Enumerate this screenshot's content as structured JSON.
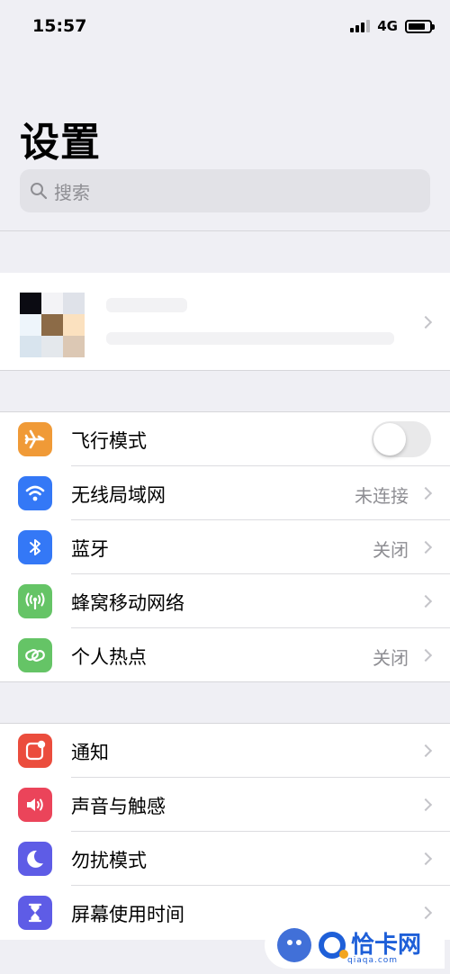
{
  "status_bar": {
    "time": "15:57",
    "network": "4G",
    "signal_bars_active": 3,
    "signal_bars_total": 4
  },
  "header": {
    "title": "设置"
  },
  "search": {
    "placeholder": "搜索"
  },
  "profile": {
    "avatar_colors": [
      "#0b0b12",
      "#f3f3f6",
      "#dfe2e9",
      "#eef5fb",
      "#8c6b47",
      "#fbe1bf",
      "#d8e4ee",
      "#e4e8ec",
      "#dcc8b4"
    ]
  },
  "connectivity": {
    "items": [
      {
        "label": "飞行模式",
        "icon": "airplane-icon",
        "color": "#f09a37",
        "toggle": false
      },
      {
        "label": "无线局域网",
        "icon": "wifi-icon",
        "color": "#3478f6",
        "value": "未连接"
      },
      {
        "label": "蓝牙",
        "icon": "bluetooth-icon",
        "color": "#3478f6",
        "value": "关闭"
      },
      {
        "label": "蜂窝移动网络",
        "icon": "antenna-icon",
        "color": "#65c466"
      },
      {
        "label": "个人热点",
        "icon": "hotspot-icon",
        "color": "#65c466",
        "value": "关闭"
      }
    ]
  },
  "system": {
    "items": [
      {
        "label": "通知",
        "icon": "notification-icon",
        "color": "#eb4d3d"
      },
      {
        "label": "声音与触感",
        "icon": "sound-icon",
        "color": "#eb445a"
      },
      {
        "label": "勿扰模式",
        "icon": "moon-icon",
        "color": "#5e5ce6"
      },
      {
        "label": "屏幕使用时间",
        "icon": "hourglass-icon",
        "color": "#5e5ce6"
      }
    ]
  },
  "watermark": {
    "text": "恰卡网",
    "url": "qiaqa.com"
  }
}
